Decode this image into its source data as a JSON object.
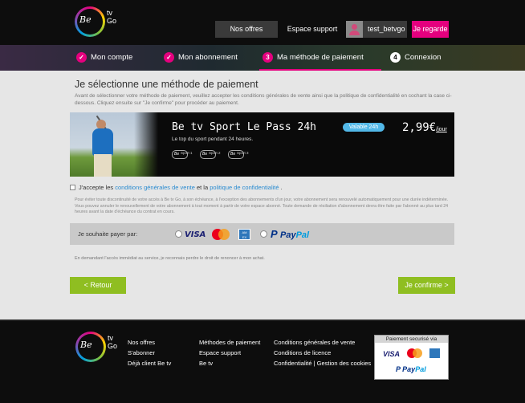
{
  "brand": {
    "logo_text": "Be",
    "logo_sub": "tv Go"
  },
  "header": {
    "offres_label": "Nos offres",
    "support_label": "Espace support",
    "username": "test_betvgo",
    "regarde_label": "Je regarde"
  },
  "steps": [
    {
      "number": "✓",
      "label": "Mon compte",
      "state": "done"
    },
    {
      "number": "✓",
      "label": "Mon abonnement",
      "state": "done"
    },
    {
      "number": "3",
      "label": "Ma méthode de paiement",
      "state": "active"
    },
    {
      "number": "4",
      "label": "Connexion",
      "state": "todo"
    }
  ],
  "main": {
    "title": "Je sélectionne une méthode de paiement",
    "intro": "Avant de sélectionner votre méthode de paiement, veuillez accepter les conditions générales de vente ainsi que la politique de confidentialité en cochant la case ci-dessous. Cliquez ensuite sur \"Je confirme\" pour procéder au paiement."
  },
  "offer": {
    "name": "Be tv Sport Le Pass 24h",
    "subtitle": "Le top du sport pendant 24 heures.",
    "badge": "Valable 24h",
    "price": "2,99€",
    "price_unit": "/jour",
    "channels": [
      {
        "logo": "Be",
        "name": "Sport 1"
      },
      {
        "logo": "Be",
        "name": "Sport 2"
      },
      {
        "logo": "Be",
        "name": "Sport 3"
      }
    ]
  },
  "terms": {
    "prefix": "J'accepte les ",
    "cgv_link": "conditions générales de vente",
    "middle": " et la ",
    "privacy_link": "politique de confidentialité",
    "suffix": " .",
    "checked": false
  },
  "legal_text": "Pour éviter toute discontinuité de votre accès à Be tv Go, à son échéance, à l'exception des abonnements d'un jour, votre abonnement sera renouvelé automatiquement pour une durée indéterminée. Vous pouvez annuler le renouvellement de votre abonnement à tout moment à partir de votre espace abonné. Toute demande de résiliation d'abonnement devra être faite par l'abonné au plus tard 24 heures avant la date d'échéance du contrat en cours.",
  "payment": {
    "label": "Je souhaite payer par:",
    "options": [
      {
        "name": "VISA"
      },
      {
        "name": "MasterCard"
      },
      {
        "name": "American Express"
      },
      {
        "name": "PayPal",
        "part1": "Pay",
        "part2": "Pal"
      }
    ]
  },
  "renounce_text": "En demandant l'accès immédiat au service, je reconnais perdre le droit de renoncer à mon achat.",
  "actions": {
    "back_label": "< Retour",
    "confirm_label": "Je confirme >"
  },
  "footer": {
    "col1": [
      "Nos offres",
      "S'abonner",
      "Déjà client Be tv"
    ],
    "col2": [
      "Méthodes de paiement",
      "Espace support",
      "Be tv"
    ],
    "col3": [
      "Conditions générales de vente",
      "Conditions de licence",
      "Confidentialité | Gestion des cookies"
    ],
    "secure_title": "Paiement securisé via",
    "secure_logos": [
      "VISA",
      "MasterCard",
      "American Express",
      "PayPal"
    ]
  },
  "colors": {
    "accent": "#e5007e",
    "green": "#8fbe21",
    "link": "#2a8bd0",
    "badge": "#52b8e8"
  }
}
